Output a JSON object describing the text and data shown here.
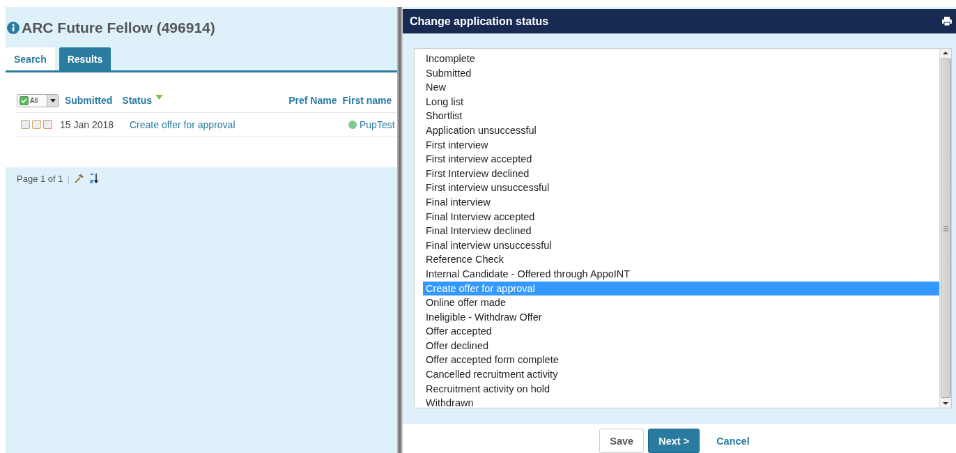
{
  "page": {
    "title": "ARC Future Fellow (496914)",
    "tabs": [
      {
        "label": "Search",
        "selected": false
      },
      {
        "label": "Results",
        "selected": true
      }
    ],
    "table": {
      "select_all": {
        "label": "All",
        "checked": true
      },
      "columns": [
        {
          "label": "Submitted",
          "sorted": false
        },
        {
          "label": "Status",
          "sorted": true
        },
        {
          "label": "Pref Name",
          "sorted": false
        },
        {
          "label": "First name",
          "sorted": false
        }
      ],
      "rows": [
        {
          "flags": [
            {
              "color": "#8fbf7f",
              "checked": false
            },
            {
              "color": "#d9a860",
              "checked": false
            },
            {
              "color": "#d98a7a",
              "checked": false
            }
          ],
          "submitted": "15 Jan 2018",
          "status": "Create offer for approval",
          "pref_name": "",
          "first_name": "PupTest",
          "online": true
        }
      ]
    },
    "pager": {
      "text": "Page 1 of 1",
      "separator": "|"
    }
  },
  "dialog": {
    "title": "Change application status",
    "options": [
      {
        "label": "Incomplete",
        "selected": false
      },
      {
        "label": "Submitted",
        "selected": false
      },
      {
        "label": "New",
        "selected": false
      },
      {
        "label": "Long list",
        "selected": false
      },
      {
        "label": "Shortlist",
        "selected": false
      },
      {
        "label": "Application unsuccessful",
        "selected": false
      },
      {
        "label": "First interview",
        "selected": false
      },
      {
        "label": "First interview accepted",
        "selected": false
      },
      {
        "label": "First Interview declined",
        "selected": false
      },
      {
        "label": "First interview unsuccessful",
        "selected": false
      },
      {
        "label": "Final interview",
        "selected": false
      },
      {
        "label": "Final Interview accepted",
        "selected": false
      },
      {
        "label": "Final Interview declined",
        "selected": false
      },
      {
        "label": "Final interview unsuccessful",
        "selected": false
      },
      {
        "label": "Reference Check",
        "selected": false
      },
      {
        "label": "Internal Candidate - Offered through AppoINT",
        "selected": false
      },
      {
        "label": "Create offer for approval",
        "selected": true
      },
      {
        "label": "Online offer made",
        "selected": false
      },
      {
        "label": "Ineligible - Withdraw Offer",
        "selected": false
      },
      {
        "label": "Offer accepted",
        "selected": false
      },
      {
        "label": "Offer declined",
        "selected": false
      },
      {
        "label": "Offer accepted form complete",
        "selected": false
      },
      {
        "label": "Cancelled recruitment activity",
        "selected": false
      },
      {
        "label": "Recruitment activity on hold",
        "selected": false
      },
      {
        "label": "Withdrawn",
        "selected": false
      }
    ],
    "buttons": [
      {
        "label": "Save",
        "kind": "secondary"
      },
      {
        "label": "Next >",
        "kind": "primary"
      },
      {
        "label": "Cancel",
        "kind": "link"
      }
    ]
  }
}
